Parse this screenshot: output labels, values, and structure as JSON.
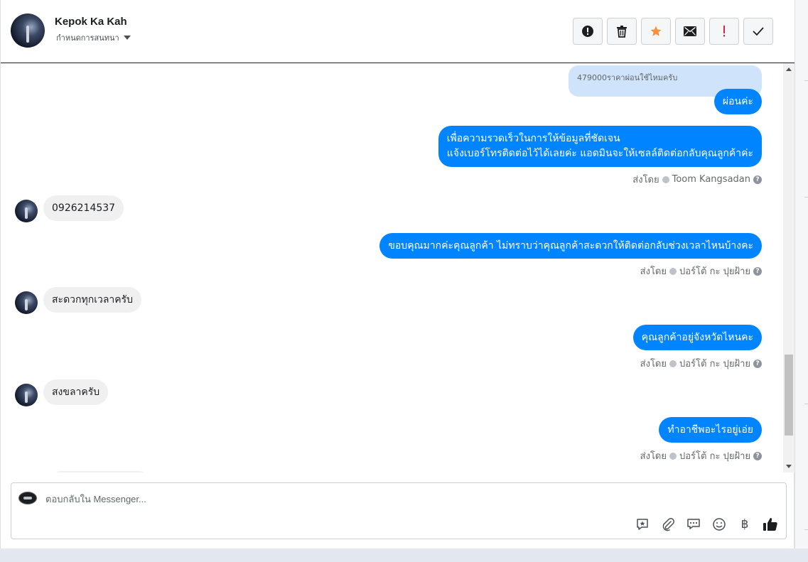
{
  "contact": {
    "name": "Kepok Ka Kah",
    "assign_label": "กำหนดการสนทนา"
  },
  "toolbar": {
    "buttons": [
      {
        "name": "alert-icon",
        "color": "#1c1e21"
      },
      {
        "name": "trash-icon",
        "color": "#1c1e21"
      },
      {
        "name": "star-icon",
        "color": "#f7923a"
      },
      {
        "name": "envelope-icon",
        "color": "#1c1e21"
      },
      {
        "name": "exclamation-icon",
        "color": "#e41e3f"
      },
      {
        "name": "checkmark-icon",
        "color": "#1c1e21"
      }
    ]
  },
  "colors": {
    "outgoing_bubble": "#0084ff",
    "incoming_bubble": "#f1f0f0",
    "quoted_bubble": "#cfe3fb"
  },
  "messages": {
    "quoted_text": "479000ราคาผ่อนใช้ไหมครับ",
    "m1": "ผ่อนค่ะ",
    "m2_line1": "เพื่อความรวดเร็วในการให้ข้อมูลที่ชัดเจน",
    "m2_line2": "แจ้งเบอร์โทรติดต่อไว้ได้เลยค่ะ แอดมินจะให้เซลล์ติดต่อกลับคุณลูกค้าค่ะ",
    "m2_sent_by": "ส่งโดย",
    "m2_agent": "Toom Kangsadan",
    "m3": "0926214537",
    "m4": "ขอบคุณมากค่ะคุณลูกค้า ไม่ทราบว่าคุณลูกค้าสะดวกให้ติดต่อกลับช่วงเวลาไหนบ้างคะ",
    "m4_sent_by": "ส่งโดย",
    "m4_agent": "ปอร์โต้ กะ ปุยฝ้าย",
    "m5": "สะดวกทุกเวลาครับ",
    "m6": "คุณลูกค้าอยู่จังหวัดไหนคะ",
    "m6_sent_by": "ส่งโดย",
    "m6_agent": "ปอร์โต้ กะ ปุยฝ้าย",
    "m7": "สงขลาครับ",
    "m8": "ทำอาชีพอะไรอยู่เอ่ย",
    "m8_sent_by": "ส่งโดย",
    "m8_agent": "ปอร์โต้ กะ ปุยฝ้าย"
  },
  "composer": {
    "placeholder": "ตอบกลับใน Messenger...",
    "icons": [
      "saved-reply-icon",
      "attachment-icon",
      "chat-bubbles-icon",
      "emoji-icon",
      "baht-icon",
      "thumbs-up-icon"
    ],
    "baht_symbol": "฿"
  }
}
